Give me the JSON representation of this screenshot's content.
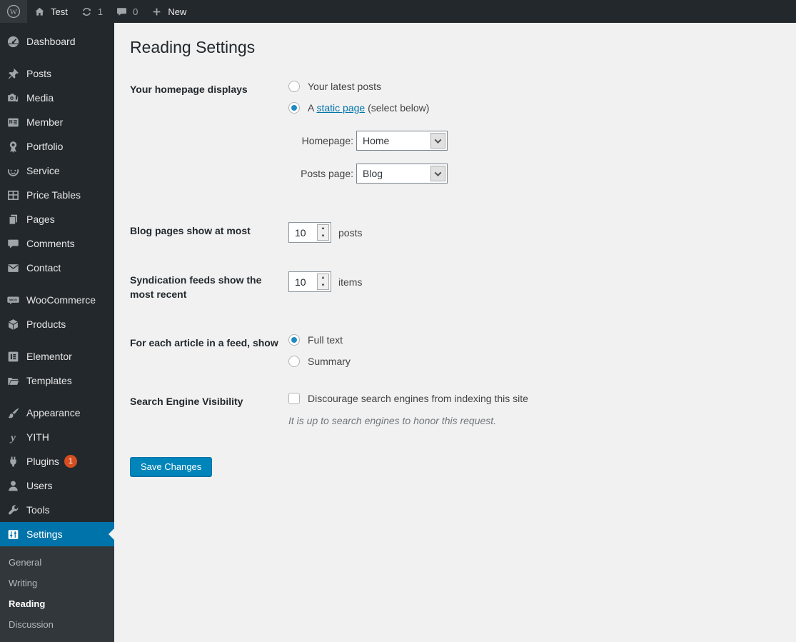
{
  "admin_bar": {
    "site_name": "Test",
    "updates_count": "1",
    "comments_count": "0",
    "new_label": "New"
  },
  "sidebar": {
    "items": [
      {
        "id": "dashboard",
        "label": "Dashboard",
        "icon": "dashboard"
      },
      {
        "id": "posts",
        "label": "Posts",
        "icon": "pushpin",
        "gap_before": true
      },
      {
        "id": "media",
        "label": "Media",
        "icon": "media"
      },
      {
        "id": "member",
        "label": "Member",
        "icon": "member"
      },
      {
        "id": "portfolio",
        "label": "Portfolio",
        "icon": "award"
      },
      {
        "id": "service",
        "label": "Service",
        "icon": "smiley"
      },
      {
        "id": "price-tables",
        "label": "Price Tables",
        "icon": "grid"
      },
      {
        "id": "pages",
        "label": "Pages",
        "icon": "pages"
      },
      {
        "id": "comments",
        "label": "Comments",
        "icon": "comment"
      },
      {
        "id": "contact",
        "label": "Contact",
        "icon": "envelope"
      },
      {
        "id": "woocommerce",
        "label": "WooCommerce",
        "icon": "woocommerce",
        "gap_before": true
      },
      {
        "id": "products",
        "label": "Products",
        "icon": "cube"
      },
      {
        "id": "elementor",
        "label": "Elementor",
        "icon": "elementor",
        "gap_before": true
      },
      {
        "id": "templates",
        "label": "Templates",
        "icon": "folder"
      },
      {
        "id": "appearance",
        "label": "Appearance",
        "icon": "brush",
        "gap_before": true
      },
      {
        "id": "yith",
        "label": "YITH",
        "icon": "yith"
      },
      {
        "id": "plugins",
        "label": "Plugins",
        "icon": "plug",
        "badge": "1"
      },
      {
        "id": "users",
        "label": "Users",
        "icon": "user"
      },
      {
        "id": "tools",
        "label": "Tools",
        "icon": "wrench"
      },
      {
        "id": "settings",
        "label": "Settings",
        "icon": "sliders",
        "active": true
      }
    ],
    "settings_submenu": [
      {
        "id": "general",
        "label": "General"
      },
      {
        "id": "writing",
        "label": "Writing"
      },
      {
        "id": "reading",
        "label": "Reading",
        "current": true
      },
      {
        "id": "discussion",
        "label": "Discussion"
      }
    ]
  },
  "main": {
    "title": "Reading Settings",
    "homepage_row": {
      "label": "Your homepage displays",
      "latest_posts_option": "Your latest posts",
      "static_prefix": "A",
      "static_link": "static page",
      "static_suffix": "(select below)",
      "homepage_label": "Homepage:",
      "homepage_value": "Home",
      "posts_page_label": "Posts page:",
      "posts_page_value": "Blog"
    },
    "blog_pages_row": {
      "label": "Blog pages show at most",
      "value": "10",
      "unit": "posts"
    },
    "syndication_row": {
      "label": "Syndication feeds show the most recent",
      "value": "10",
      "unit": "items"
    },
    "feed_row": {
      "label": "For each article in a feed, show",
      "full_text_option": "Full text",
      "summary_option": "Summary"
    },
    "seo_row": {
      "label": "Search Engine Visibility",
      "checkbox_label": "Discourage search engines from indexing this site",
      "note": "It is up to search engines to honor this request."
    },
    "save_button_label": "Save Changes"
  },
  "colors": {
    "admin_bar_bg": "#23282d",
    "sidebar_bg": "#23282d",
    "submenu_bg": "#32373c",
    "active_bg": "#0073aa",
    "link": "#0073aa",
    "button_bg": "#0085ba",
    "button_border": "#0073aa",
    "badge_bg": "#d54e21",
    "content_bg": "#f1f1f1",
    "radio_checked": "#1e8cbe"
  }
}
